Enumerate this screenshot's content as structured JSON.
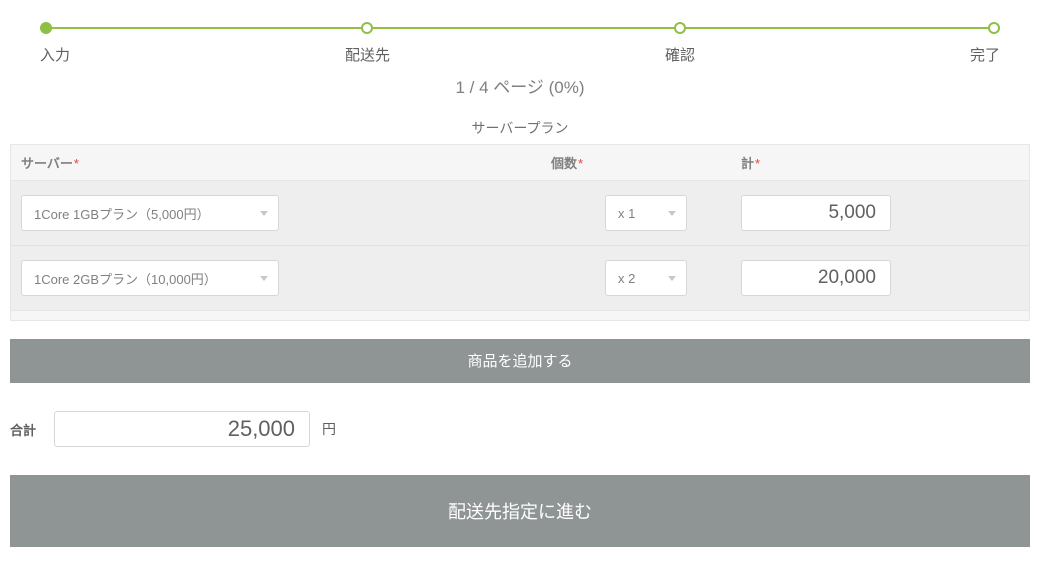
{
  "progress": {
    "steps": [
      "入力",
      "配送先",
      "確認",
      "完了"
    ],
    "current_index": 0,
    "page_indicator": "1 / 4 ページ (0%)"
  },
  "section_title": "サーバープラン",
  "columns": {
    "server": "サーバー",
    "qty": "個数",
    "subtotal": "計"
  },
  "required_mark": "*",
  "rows": [
    {
      "plan": "1Core 1GBプラン（5,000円）",
      "qty": "x 1",
      "subtotal": "5,000"
    },
    {
      "plan": "1Core 2GBプラン（10,000円）",
      "qty": "x 2",
      "subtotal": "20,000"
    }
  ],
  "add_button": "商品を追加する",
  "total": {
    "label": "合計",
    "value": "25,000",
    "unit": "円"
  },
  "next_button": "配送先指定に進む"
}
